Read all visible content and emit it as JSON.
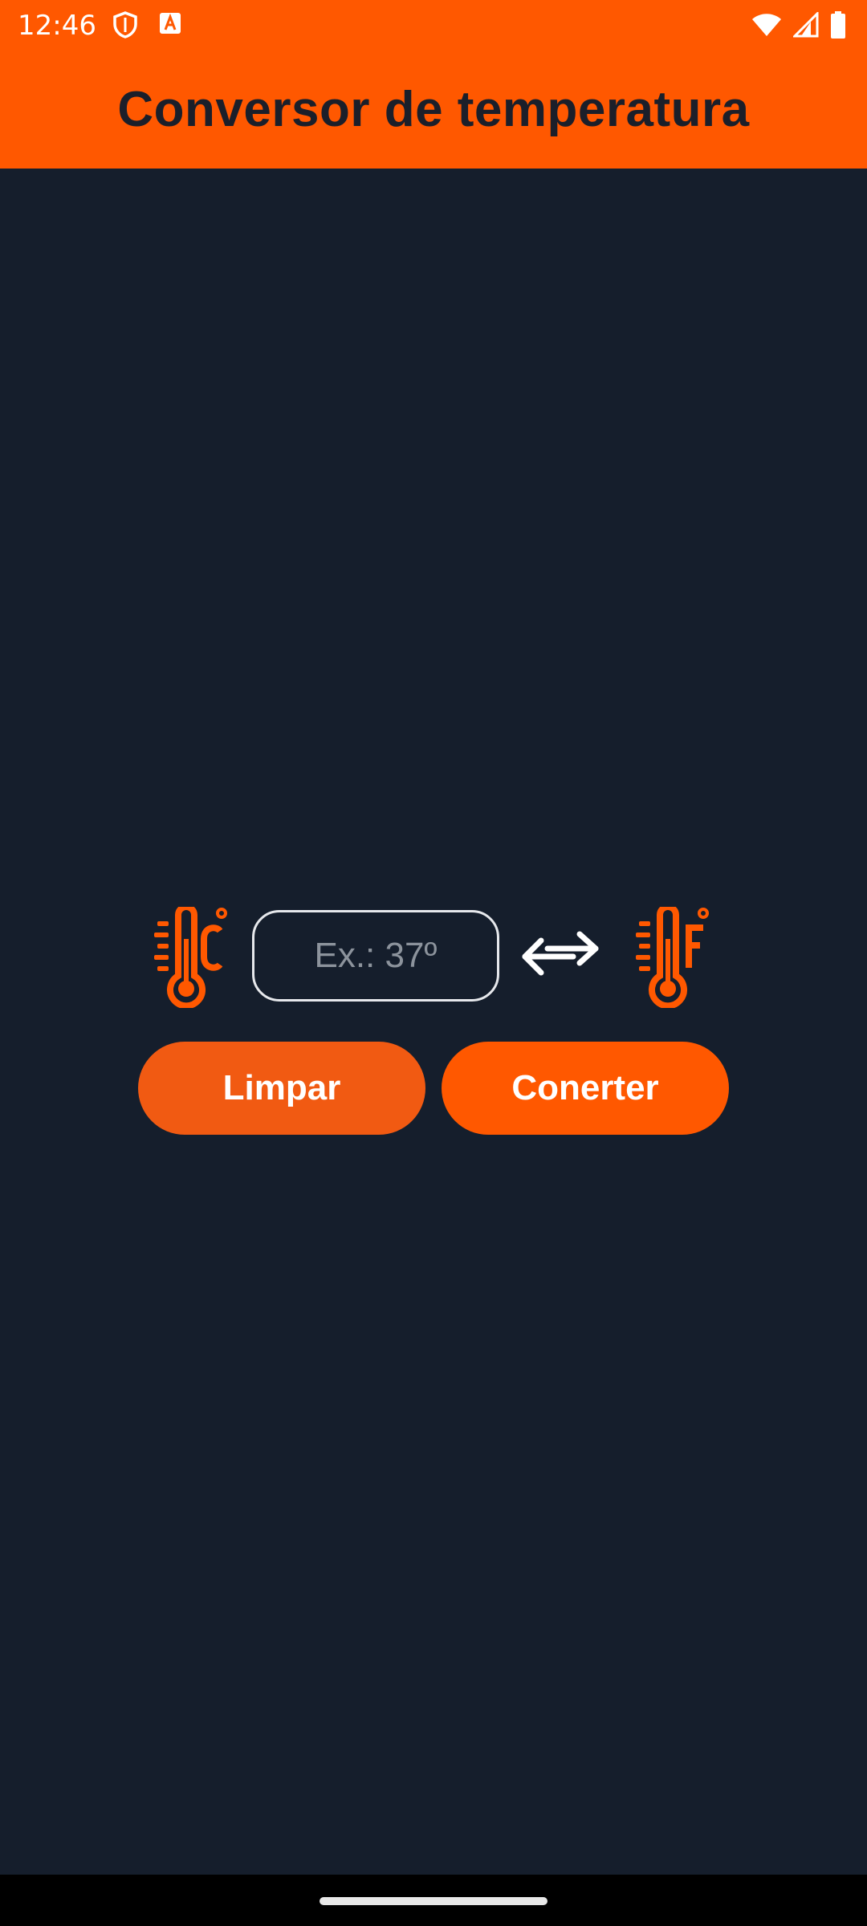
{
  "status_bar": {
    "time": "12:46",
    "left_icons": [
      "shield-icon",
      "text-a-icon"
    ],
    "right_icons": [
      "wifi-icon",
      "signal-icon",
      "battery-icon"
    ]
  },
  "app_bar": {
    "title": "Conversor de temperatura"
  },
  "colors": {
    "accent": "#ff5800",
    "background": "#151e2c",
    "title_text": "#1b1f2a",
    "button_text": "#ffffff",
    "input_border": "#e6e8ec"
  },
  "converter": {
    "from_icon": "thermometer-celsius-icon",
    "to_icon": "thermometer-fahrenheit-icon",
    "swap_icon": "swap-arrows-icon",
    "input": {
      "value": "",
      "placeholder": "Ex.: 37º"
    }
  },
  "buttons": {
    "clear_label": "Limpar",
    "convert_label": "Conerter"
  }
}
